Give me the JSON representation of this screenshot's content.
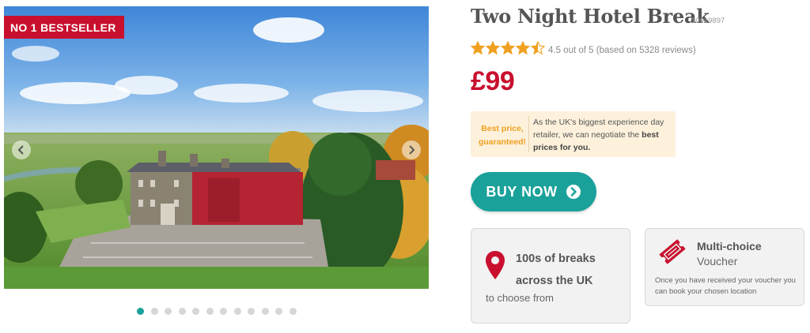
{
  "gallery": {
    "badge": "NO 1 BESTSELLER",
    "slides_total": 12,
    "active_slide": 1
  },
  "product": {
    "title": "Two Night Hotel Break",
    "sku": "10919897",
    "rating_value": 4.5,
    "rating_text": "4.5 out of 5 (based on 5328 reviews)",
    "price": "£99"
  },
  "promo": {
    "label_line1": "Best price,",
    "label_line2": "guaranteed!",
    "text_plain": "As the UK's biggest experience day retailer, we can negotiate the ",
    "text_bold": "best prices for you."
  },
  "buy_button": {
    "label": "BUY NOW"
  },
  "card_breaks": {
    "line1": "100s of breaks",
    "line2": "across the UK",
    "line3": "to choose from"
  },
  "card_voucher": {
    "title": "Multi-choice",
    "subtitle": "Voucher",
    "text": "Once you have received your voucher you can book your chosen location"
  },
  "colors": {
    "brand_red": "#c8102e",
    "teal": "#1aa19a",
    "star": "#f0a020",
    "promo_bg": "#fdf1dc"
  },
  "icons": [
    "chevron-left-icon",
    "chevron-right-icon",
    "star-icon",
    "chevron-right-circle-icon",
    "map-pin-icon",
    "ticket-icon"
  ]
}
